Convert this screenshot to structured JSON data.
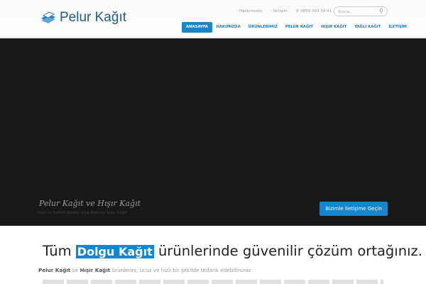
{
  "brand": {
    "name": "Pelur Kağıt"
  },
  "top_links": [
    "› Hakkımızda",
    "› İletişim"
  ],
  "phone": "0850 303 34 41",
  "search": {
    "placeholder": "Arama"
  },
  "nav": [
    "ANASAYFA",
    "HAKIMIZDA",
    "ÜRÜNLERIMIZ",
    "PELÜR KAĞIT",
    "HIŞIR KAĞIT",
    "YAĞLI KAĞIT",
    "İLETİŞİM"
  ],
  "hero": {
    "title": "Pelur Kağıt ve Hışır Kağıt",
    "subtitle": "Ucuz ve Kaliteli Baskılı veya Baskısız Pelur Kağıt",
    "cta": "Bizimle İletişime Geçin"
  },
  "intro": {
    "pre": "Tüm",
    "highlight": "Dolgu Kağıt",
    "post": "ürünlerinde güvenilir çözüm ortağınız.",
    "p_b1": "Pelur Kağıt",
    "p_t1": " ve ",
    "p_b2": "Hışır Kağıt",
    "p_t2": " ürünlerini, ucuz ve hızlı bir şekilde tedarik edebilirsiniz."
  }
}
